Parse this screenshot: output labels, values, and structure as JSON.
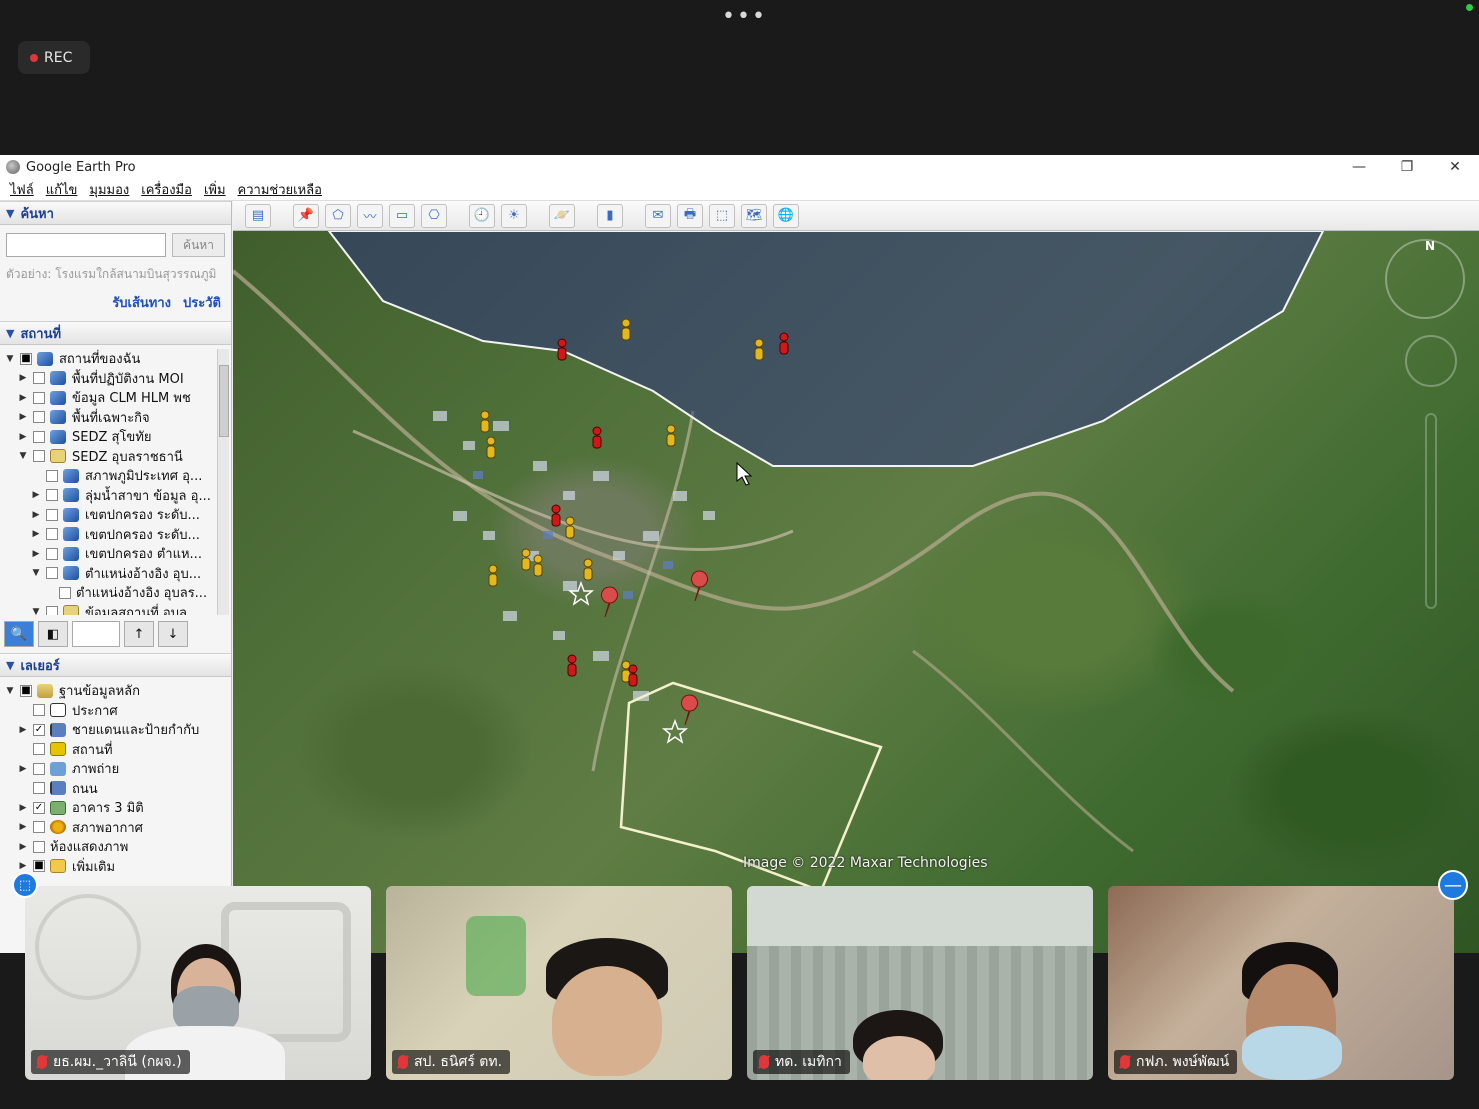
{
  "zoom": {
    "more_dots": "•••",
    "rec_label": "REC"
  },
  "window": {
    "title": "Google Earth Pro",
    "controls": [
      "—",
      "❐",
      "✕"
    ]
  },
  "menu": [
    "ไฟล์",
    "แก้ไข",
    "มุมมอง",
    "เครื่องมือ",
    "เพิ่ม",
    "ความช่วยเหลือ"
  ],
  "search": {
    "header": "ค้นหา",
    "input_value": "",
    "button": "ค้นหา",
    "example": "ตัวอย่าง: โรงแรมใกล้สนามบินสุวรรณภูมิ",
    "link_directions": "รับเส้นทาง",
    "link_history": "ประวัติ"
  },
  "places": {
    "header": "สถานที่",
    "items": [
      {
        "label": "สถานที่ของฉัน",
        "indent": 0,
        "arrow": "▼",
        "check": "■",
        "icon": "globe"
      },
      {
        "label": "พื้นที่ปฏิบัติงาน MOI",
        "indent": 1,
        "arrow": "▶",
        "check": "",
        "icon": "globe"
      },
      {
        "label": "ข้อมูล CLM HLM พช",
        "indent": 1,
        "arrow": "▶",
        "check": "",
        "icon": "globe"
      },
      {
        "label": "พื้นที่เฉพาะกิจ",
        "indent": 1,
        "arrow": "▶",
        "check": "",
        "icon": "globe"
      },
      {
        "label": "SEDZ สุโขทัย",
        "indent": 1,
        "arrow": "▶",
        "check": "",
        "icon": "globe"
      },
      {
        "label": "SEDZ อุบลราชธานี",
        "indent": 1,
        "arrow": "▼",
        "check": "",
        "icon": "folder"
      },
      {
        "label": "สภาพภูมิประเทศ อุ...",
        "indent": 2,
        "arrow": "",
        "check": "",
        "icon": "globe"
      },
      {
        "label": "ลุ่มน้ำสาขา ข้อมูล อุ...",
        "indent": 2,
        "arrow": "▶",
        "check": "",
        "icon": "globe"
      },
      {
        "label": "เขตปกครอง ระดับ...",
        "indent": 2,
        "arrow": "▶",
        "check": "",
        "icon": "globe"
      },
      {
        "label": "เขตปกครอง ระดับ...",
        "indent": 2,
        "arrow": "▶",
        "check": "",
        "icon": "globe"
      },
      {
        "label": "เขตปกครอง ตำแห...",
        "indent": 2,
        "arrow": "▶",
        "check": "",
        "icon": "globe"
      },
      {
        "label": "ตำแหน่งอ้างอิง อุบ...",
        "indent": 2,
        "arrow": "▼",
        "check": "",
        "icon": "globe"
      },
      {
        "label": "ตำแหน่งอ้างอิง อุบลร...",
        "indent": 3,
        "arrow": "",
        "check": "",
        "icon": ""
      },
      {
        "label": "ข้อมูลสถานที่ อุบล...",
        "indent": 2,
        "arrow": "▼",
        "check": "",
        "icon": "folder"
      }
    ],
    "tools": [
      "🔍",
      "◧",
      "",
      "↑",
      "↓"
    ]
  },
  "layers": {
    "header": "เลเยอร์",
    "items": [
      {
        "label": "ฐานข้อมูลหลัก",
        "indent": 0,
        "arrow": "▼",
        "check": "■",
        "icon": "layers"
      },
      {
        "label": "ประกาศ",
        "indent": 1,
        "arrow": "",
        "check": "",
        "icon": "mail"
      },
      {
        "label": "ชายแดนและป้ายกำกับ",
        "indent": 1,
        "arrow": "▶",
        "check": "✓",
        "icon": "flag"
      },
      {
        "label": "สถานที่",
        "indent": 1,
        "arrow": "",
        "check": "",
        "icon": "place"
      },
      {
        "label": "ภาพถ่าย",
        "indent": 1,
        "arrow": "▶",
        "check": "",
        "icon": "photo"
      },
      {
        "label": "ถนน",
        "indent": 1,
        "arrow": "",
        "check": "",
        "icon": "flag"
      },
      {
        "label": "อาคาร 3 มิติ",
        "indent": 1,
        "arrow": "▶",
        "check": "✓",
        "icon": "build"
      },
      {
        "label": "สภาพอากาศ",
        "indent": 1,
        "arrow": "▶",
        "check": "",
        "icon": "sun"
      },
      {
        "label": "ห้องแสดงภาพ",
        "indent": 1,
        "arrow": "▶",
        "check": "",
        "icon": ""
      },
      {
        "label": "เพิ่มเติม",
        "indent": 1,
        "arrow": "▶",
        "check": "■",
        "icon": "more"
      }
    ]
  },
  "toolbar_icons": [
    "▤",
    "📌",
    "⬠",
    "〰",
    "▭",
    "⎔",
    "🕘",
    "☀",
    "🪐",
    "▮",
    "✉",
    "🖶",
    "⬚",
    "🗺",
    "🌐"
  ],
  "map": {
    "copyright": "Image © 2022 Maxar Technologies",
    "compass_label": "N"
  },
  "participants": [
    {
      "name": "ยธ.ผม._วาลินี (กผจ.)"
    },
    {
      "name": "สป. ธนิศร์ ตท."
    },
    {
      "name": "ทด. เมทิกา"
    },
    {
      "name": "กฟภ. พงษ์พัฒน์"
    }
  ]
}
